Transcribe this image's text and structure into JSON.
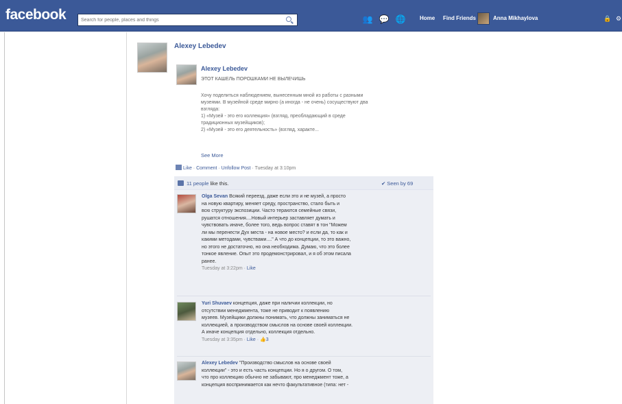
{
  "header": {
    "logo": "facebook",
    "search_placeholder": "Search for people, places and things",
    "nav": {
      "home": "Home",
      "find_friends": "Find Friends",
      "user_name": "Anna Mikhaylova"
    }
  },
  "post": {
    "author": "Alexey Lebedev",
    "shared_author": "Alexey Lebedev",
    "title": "ЭТОТ КАШЕЛЬ ПОРОШКАМИ НЕ ВЫЛЕЧИШЬ",
    "body_lines": [
      "Хочу поделиться наблюдением, вынесенным мной из работы с разными",
      "музеями. В музейной среде мирно (а иногда - не очень) сосуществуют два",
      "взгляда:",
      "1) «Музей - это его коллекция» (взгляд, преобладающий в среде",
      "традиционных музейщиков);",
      "2) «Музей - это его деятельность» (взгляд, характе..."
    ],
    "see_more": "See More",
    "actions": {
      "like": "Like",
      "comment": "Comment",
      "unfollow": "Unfollow Post",
      "time": "Tuesday at 3:10pm"
    }
  },
  "likes": {
    "count_link": "11 people",
    "suffix": "like this.",
    "seen": "Seen by 69"
  },
  "comments": [
    {
      "author": "Olga Sevan",
      "lines": [
        "Всякий переезд, даже если это и не музей, а просто",
        "на новую квартиру, меняет среду, пространство, стало быть и",
        "всю структуру экспозиции. Часто тераются семейные связи,",
        "рушатся отношения....Новый интерьер заставляет думать и",
        "чувствовать иначе, более того, ведь вопрос ставят в тон \"Можем",
        "ли мы перенести Дух места - на новое место? и если да, то как и",
        "какими методами, чувствами....\" А что до концепции, то это важно,",
        "но этого не достаточно, но она необходима. Думаю, что это более",
        "тонкое явление. Опыт это продемонстрировал, и я об этом писала",
        "ранее."
      ],
      "time": "Tuesday at 3:22pm",
      "like": "Like"
    },
    {
      "author": "Yuri Shuvaev",
      "lines": [
        "концепция, даже при наличии коллекции, но",
        "отсутствии менеджмента, тоже не приводит к появлению",
        "музеев. Музейщики должны понимать, что должны заниматься не",
        "коллекцией, а производством смыслов на основе своей коллекции.",
        "А иначе концепция отдельно, коллекция отдельно."
      ],
      "time": "Tuesday at 3:35pm",
      "like": "Like",
      "likes": "3"
    },
    {
      "author": "Alexey Lebedev",
      "lines": [
        "\"Производство смыслов на основе своей",
        "коллекции\" - это и есть часть концепции. Но я о другом. О том,",
        "что про коллекцию обычно не забывают, про менеджмент тоже, а",
        "концепция воспринимается как нечто факультативное (типа: нет -"
      ]
    }
  ]
}
